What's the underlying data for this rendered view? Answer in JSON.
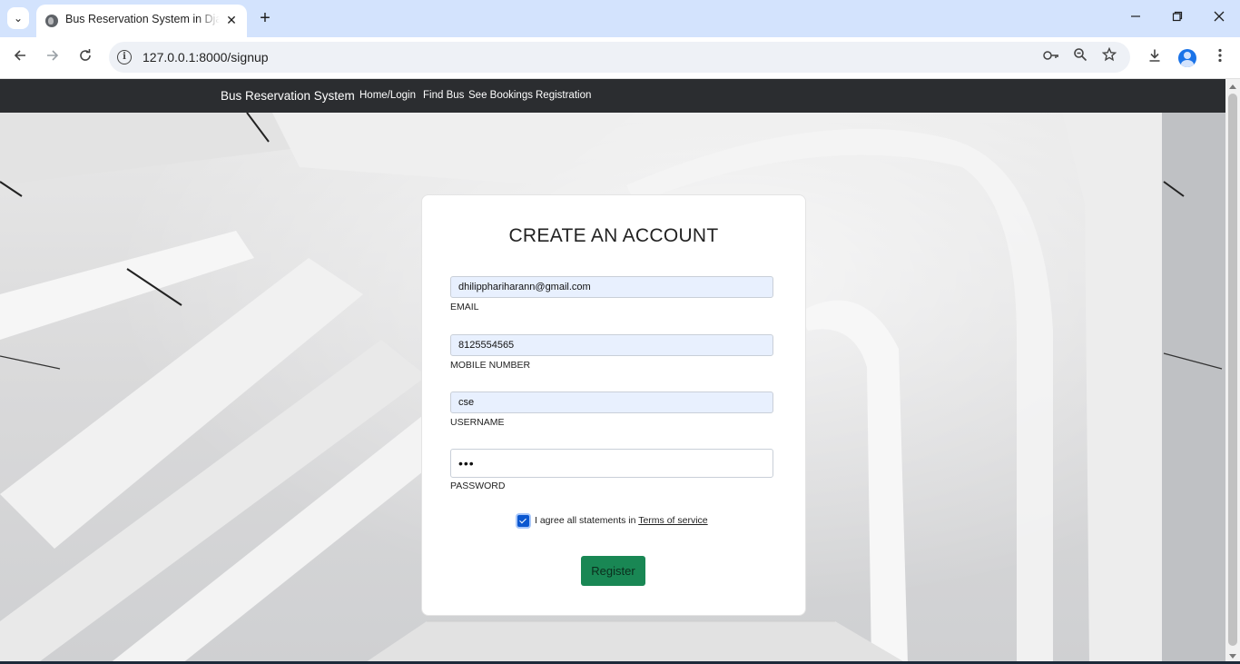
{
  "browser": {
    "tab_title": "Bus Reservation System in Django",
    "url": "127.0.0.1:8000/signup",
    "tab_close_glyph": "✕",
    "new_tab_glyph": "+",
    "icons": [
      "chevron-down-icon",
      "globe-icon",
      "back-icon",
      "forward-icon",
      "reload-icon",
      "info-icon",
      "key-icon",
      "zoom-icon",
      "star-icon",
      "download-icon",
      "profile-icon",
      "menu-icon",
      "minimize-icon",
      "restore-icon",
      "close-icon"
    ]
  },
  "navbar": {
    "brand": "Bus Reservation System",
    "links": [
      "Home/Login",
      "Find Bus",
      "See Bookings",
      "Registration"
    ]
  },
  "form": {
    "title": "CREATE AN ACCOUNT",
    "email": {
      "value": "dhilipphariharann@gmail.com",
      "label": "EMAIL"
    },
    "mobile": {
      "value": "8125554565",
      "label": "MOBILE NUMBER"
    },
    "username": {
      "value": "cse",
      "label": "USERNAME"
    },
    "password": {
      "value": "•••",
      "label": "PASSWORD"
    },
    "agree_text": "I agree all statements in",
    "terms_link": "Terms of service",
    "agree_checked": true,
    "register_label": "Register"
  },
  "colors": {
    "navbar_bg": "#2b2d30",
    "register_bg": "#198754",
    "autofill_bg": "#e8f0fe",
    "tabbar_bg": "#d3e3fd"
  }
}
